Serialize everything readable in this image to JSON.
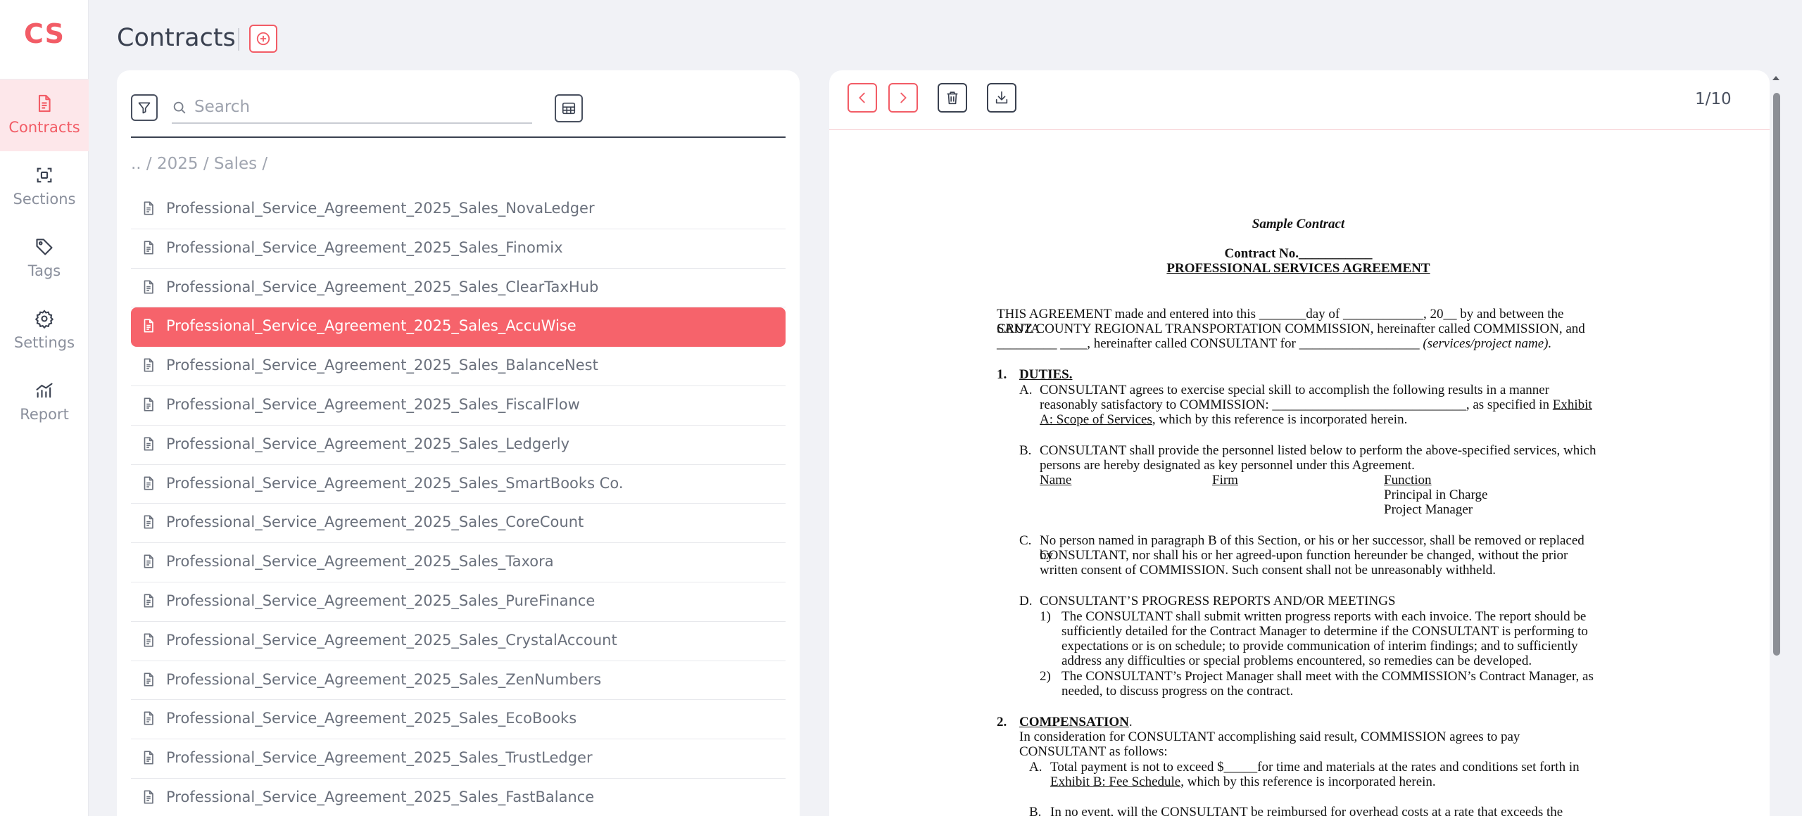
{
  "app": {
    "logo": "CS"
  },
  "sidebar": {
    "items": [
      {
        "label": "Contracts",
        "icon": "document-icon",
        "active": true
      },
      {
        "label": "Sections",
        "icon": "sections-icon",
        "active": false
      },
      {
        "label": "Tags",
        "icon": "tag-icon",
        "active": false
      },
      {
        "label": "Settings",
        "icon": "gear-icon",
        "active": false
      },
      {
        "label": "Report",
        "icon": "chart-icon",
        "active": false
      }
    ]
  },
  "header": {
    "title": "Contracts"
  },
  "list_panel": {
    "search_placeholder": "Search",
    "breadcrumb": ".. / 2025 / Sales /",
    "files": [
      "Professional_Service_Agreement_2025_Sales_NovaLedger",
      "Professional_Service_Agreement_2025_Sales_Finomix",
      "Professional_Service_Agreement_2025_Sales_ClearTaxHub",
      "Professional_Service_Agreement_2025_Sales_AccuWise",
      "Professional_Service_Agreement_2025_Sales_BalanceNest",
      "Professional_Service_Agreement_2025_Sales_FiscalFlow",
      "Professional_Service_Agreement_2025_Sales_Ledgerly",
      "Professional_Service_Agreement_2025_Sales_SmartBooks Co.",
      "Professional_Service_Agreement_2025_Sales_CoreCount",
      "Professional_Service_Agreement_2025_Sales_Taxora",
      "Professional_Service_Agreement_2025_Sales_PureFinance",
      "Professional_Service_Agreement_2025_Sales_CrystalAccount",
      "Professional_Service_Agreement_2025_Sales_ZenNumbers",
      "Professional_Service_Agreement_2025_Sales_EcoBooks",
      "Professional_Service_Agreement_2025_Sales_TrustLedger",
      "Professional_Service_Agreement_2025_Sales_FastBalance"
    ],
    "selected_index": 3
  },
  "viewer": {
    "page_indicator": "1/10",
    "doc": {
      "header_italic": "Sample Contract",
      "contract_no": "Contract No.___________",
      "agreement_title": "PROFESSIONAL SERVICES AGREEMENT",
      "intro_1": "THIS AGREEMENT made and entered into this _______day of ____________, 20__ by and between the SANTA",
      "intro_2": "CRUZ COUNTY REGIONAL TRANSPORTATION COMMISSION, hereinafter called COMMISSION, and",
      "intro_3a": "_________ ____, hereinafter called CONSULTANT for __________________ ",
      "intro_3b": "(services/project name).",
      "s1_num": "1.",
      "s1_title": "DUTIES.",
      "a_label": "A.",
      "a_1": "CONSULTANT agrees to exercise special skill to accomplish the following results in a manner",
      "a_2": "reasonably satisfactory to COMMISSION: _____________________________, as specified in ",
      "a_2_link": "Exhibit",
      "a_3_link": "A: Scope of Services",
      "a_3": ", which by this reference is incorporated herein.",
      "b_label": "B.",
      "b_1": "CONSULTANT shall provide the personnel listed below to perform the above-specified services, which",
      "b_2": "persons are hereby designated as key personnel under this Agreement.",
      "col_name": "Name",
      "col_firm": "Firm",
      "col_function": "Function",
      "fn_1": "Principal in Charge",
      "fn_2": "Project Manager",
      "c_label": "C.",
      "c_1": "No person named in paragraph B of this Section, or his or her successor, shall be removed or replaced by",
      "c_2": "CONSULTANT, nor shall his or her agreed-upon function hereunder be changed, without the prior",
      "c_3": "written consent of COMMISSION.  Such consent shall not be unreasonably withheld.",
      "d_label": "D.",
      "d_title": "CONSULTANT’S PROGRESS REPORTS AND/OR MEETINGS",
      "d1_num": "1)",
      "d1_1": "The CONSULTANT shall submit written progress reports with each invoice. The report should be",
      "d1_2": "sufficiently detailed for the Contract Manager to determine if the CONSULTANT is performing to",
      "d1_3": "expectations or is on schedule; to provide communication of interim findings; and to sufficiently",
      "d1_4": "address any difficulties or special problems encountered, so remedies can be developed.",
      "d2_num": "2)",
      "d2_1": "The CONSULTANT’s Project Manager shall meet with the COMMISSION’s Contract Manager, as",
      "d2_2": "needed, to discuss progress on the contract.",
      "s2_num": "2.",
      "s2_title": "COMPENSATION",
      "s2_dot": ".",
      "s2_1": "In consideration for CONSULTANT accomplishing said result, COMMISSION agrees to pay",
      "s2_2": "CONSULTANT as follows:",
      "s2a_label": "A.",
      "s2a_1": "Total payment is not to exceed $_____for time and materials at the rates and conditions set forth in",
      "s2a_2_link": "Exhibit B: Fee Schedule",
      "s2a_2": ", which by this reference is incorporated herein.",
      "s2b_label": "B.",
      "s2b_1": "In no event, will the CONSULTANT be reimbursed for overhead costs at a rate that exceeds the"
    }
  },
  "colors": {
    "accent": "#f25c66",
    "selected_row": "#f6636b",
    "background": "#f1f2f6"
  }
}
